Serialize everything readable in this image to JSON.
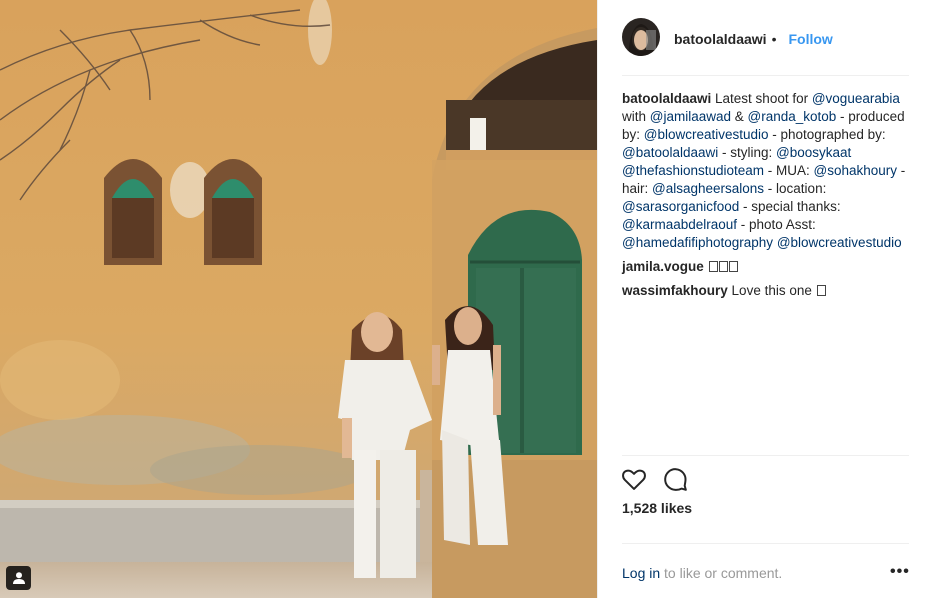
{
  "post": {
    "username": "batoolaldaawi",
    "dot": "•",
    "follow_label": "Follow",
    "caption": [
      {
        "t": "u",
        "v": "batoolaldaawi"
      },
      {
        "t": "x",
        "v": " Latest shoot for "
      },
      {
        "t": "m",
        "v": "@voguearabia"
      },
      {
        "t": "x",
        "v": " with "
      },
      {
        "t": "m",
        "v": "@jamilaawad"
      },
      {
        "t": "x",
        "v": " & "
      },
      {
        "t": "m",
        "v": "@randa_kotob"
      },
      {
        "t": "x",
        "v": " - produced by: "
      },
      {
        "t": "m",
        "v": "@blowcreativestudio"
      },
      {
        "t": "x",
        "v": " - photographed by: "
      },
      {
        "t": "m",
        "v": "@batoolaldaawi"
      },
      {
        "t": "x",
        "v": " - styling: "
      },
      {
        "t": "m",
        "v": "@boosykaat"
      },
      {
        "t": "x",
        "v": " "
      },
      {
        "t": "m",
        "v": "@thefashionstudioteam"
      },
      {
        "t": "x",
        "v": " - MUA: "
      },
      {
        "t": "m",
        "v": "@sohakhoury"
      },
      {
        "t": "x",
        "v": " - hair: "
      },
      {
        "t": "m",
        "v": "@alsagheersalons"
      },
      {
        "t": "x",
        "v": " - location: "
      },
      {
        "t": "m",
        "v": "@sarasorganicfood"
      },
      {
        "t": "x",
        "v": " - special thanks: "
      },
      {
        "t": "m",
        "v": "@karmaabdelraouf"
      },
      {
        "t": "x",
        "v": " - photo Asst: "
      },
      {
        "t": "m",
        "v": "@hamedafifiphotography"
      },
      {
        "t": "x",
        "v": " "
      },
      {
        "t": "m",
        "v": "@blowcreativestudio"
      }
    ],
    "comments": [
      {
        "user": "jamila.vogue",
        "text": " ",
        "emoji_count": 3
      },
      {
        "user": "wassimfakhoury",
        "text": " Love this one ",
        "emoji_count": 1
      }
    ],
    "likes": "1,528 likes",
    "login_link": "Log in",
    "login_rest": " to like or comment.",
    "more": "•••"
  },
  "icons": {
    "like": "heart-outline-icon",
    "comment": "speech-bubble-icon",
    "user_tag": "person-tag-icon",
    "more": "ellipsis-icon"
  },
  "colors": {
    "link_blue": "#3897f0",
    "mention_blue": "#003569",
    "muted": "#999999",
    "text": "#262626",
    "border": "#efefef"
  }
}
